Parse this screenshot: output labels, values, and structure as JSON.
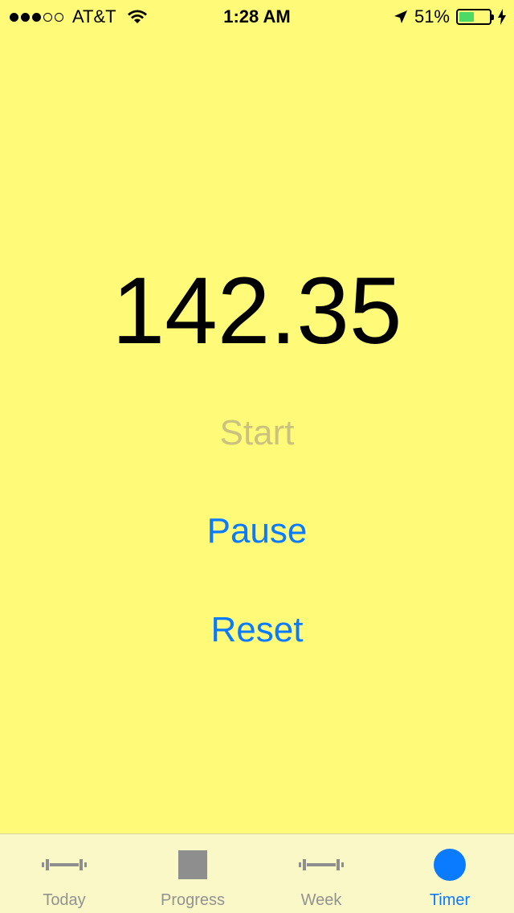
{
  "status_bar": {
    "carrier": "AT&T",
    "time": "1:28 AM",
    "battery_percent": "51%",
    "battery_level": 0.51,
    "signal_bars_filled": 3,
    "signal_bars_total": 5
  },
  "timer": {
    "value": "142.35"
  },
  "actions": {
    "start_label": "Start",
    "pause_label": "Pause",
    "reset_label": "Reset"
  },
  "tabs": [
    {
      "label": "Today",
      "icon": "barbell-icon",
      "active": false
    },
    {
      "label": "Progress",
      "icon": "square-icon",
      "active": false
    },
    {
      "label": "Week",
      "icon": "barbell-icon",
      "active": false
    },
    {
      "label": "Timer",
      "icon": "circle-icon",
      "active": true
    }
  ],
  "colors": {
    "background": "#fffa78",
    "tab_bar_background": "#fbf8c7",
    "accent": "#0a7aff",
    "disabled_text": "#ccc27f",
    "inactive_tab": "#929292"
  }
}
